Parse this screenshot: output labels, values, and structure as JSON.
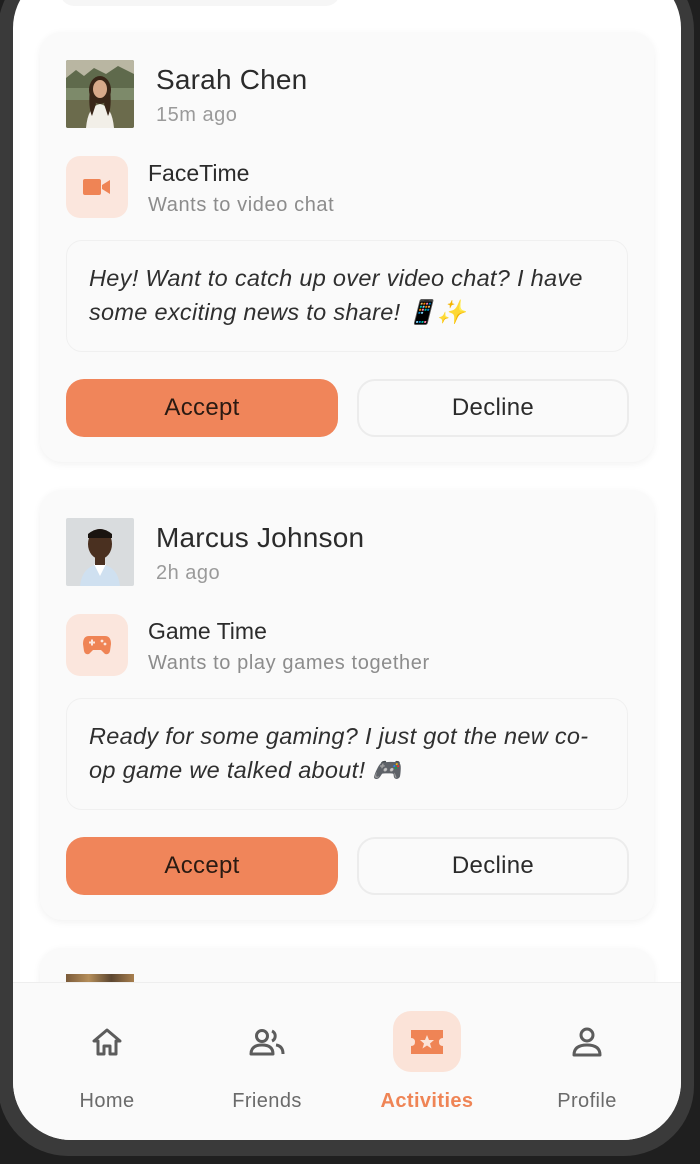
{
  "colors": {
    "accent": "#f0855a",
    "accent_soft": "#fbe6dd",
    "card_bg": "#fafafa"
  },
  "cards": [
    {
      "name": "Sarah Chen",
      "time": "15m ago",
      "activity_icon": "video-camera-icon",
      "activity_title": "FaceTime",
      "activity_subtitle": "Wants to video chat",
      "message": "Hey! Want to catch up over video chat? I have some exciting news to share! 📱✨",
      "accept_label": "Accept",
      "decline_label": "Decline"
    },
    {
      "name": "Marcus Johnson",
      "time": "2h ago",
      "activity_icon": "gamepad-icon",
      "activity_title": "Game Time",
      "activity_subtitle": "Wants to play games together",
      "message": "Ready for some gaming? I just got the new co-op game we talked about! 🎮",
      "accept_label": "Accept",
      "decline_label": "Decline"
    }
  ],
  "nav": {
    "active": "Activities",
    "items": [
      {
        "label": "Home",
        "icon": "home-icon"
      },
      {
        "label": "Friends",
        "icon": "people-icon"
      },
      {
        "label": "Activities",
        "icon": "ticket-star-icon"
      },
      {
        "label": "Profile",
        "icon": "person-icon"
      }
    ]
  }
}
